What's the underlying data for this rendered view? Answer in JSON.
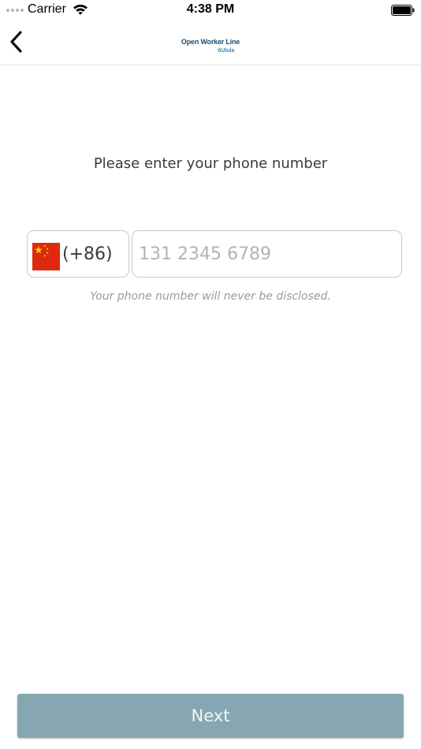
{
  "status_bar": {
    "carrier": "Carrier",
    "time": "4:38 PM",
    "icons": [
      "signal-dots-icon",
      "wifi-icon",
      "battery-icon"
    ]
  },
  "nav": {
    "back_icon": "chevron-left-icon",
    "logo_title": "Open Worker Line",
    "logo_sub": "ǒUlula"
  },
  "main": {
    "prompt": "Please enter your phone number",
    "country": {
      "flag": "china-flag-icon",
      "dial_code": "(+86)"
    },
    "phone": {
      "value": "",
      "placeholder": "131 2345 6789"
    },
    "disclaimer": "Your phone number will never be disclosed."
  },
  "footer": {
    "next_label": "Next"
  },
  "colors": {
    "brand": "#1f4f6e",
    "brand_accent": "#3a87b0",
    "button": "#86a7b1",
    "flag_red": "#de2910",
    "flag_yellow": "#ffde00"
  }
}
